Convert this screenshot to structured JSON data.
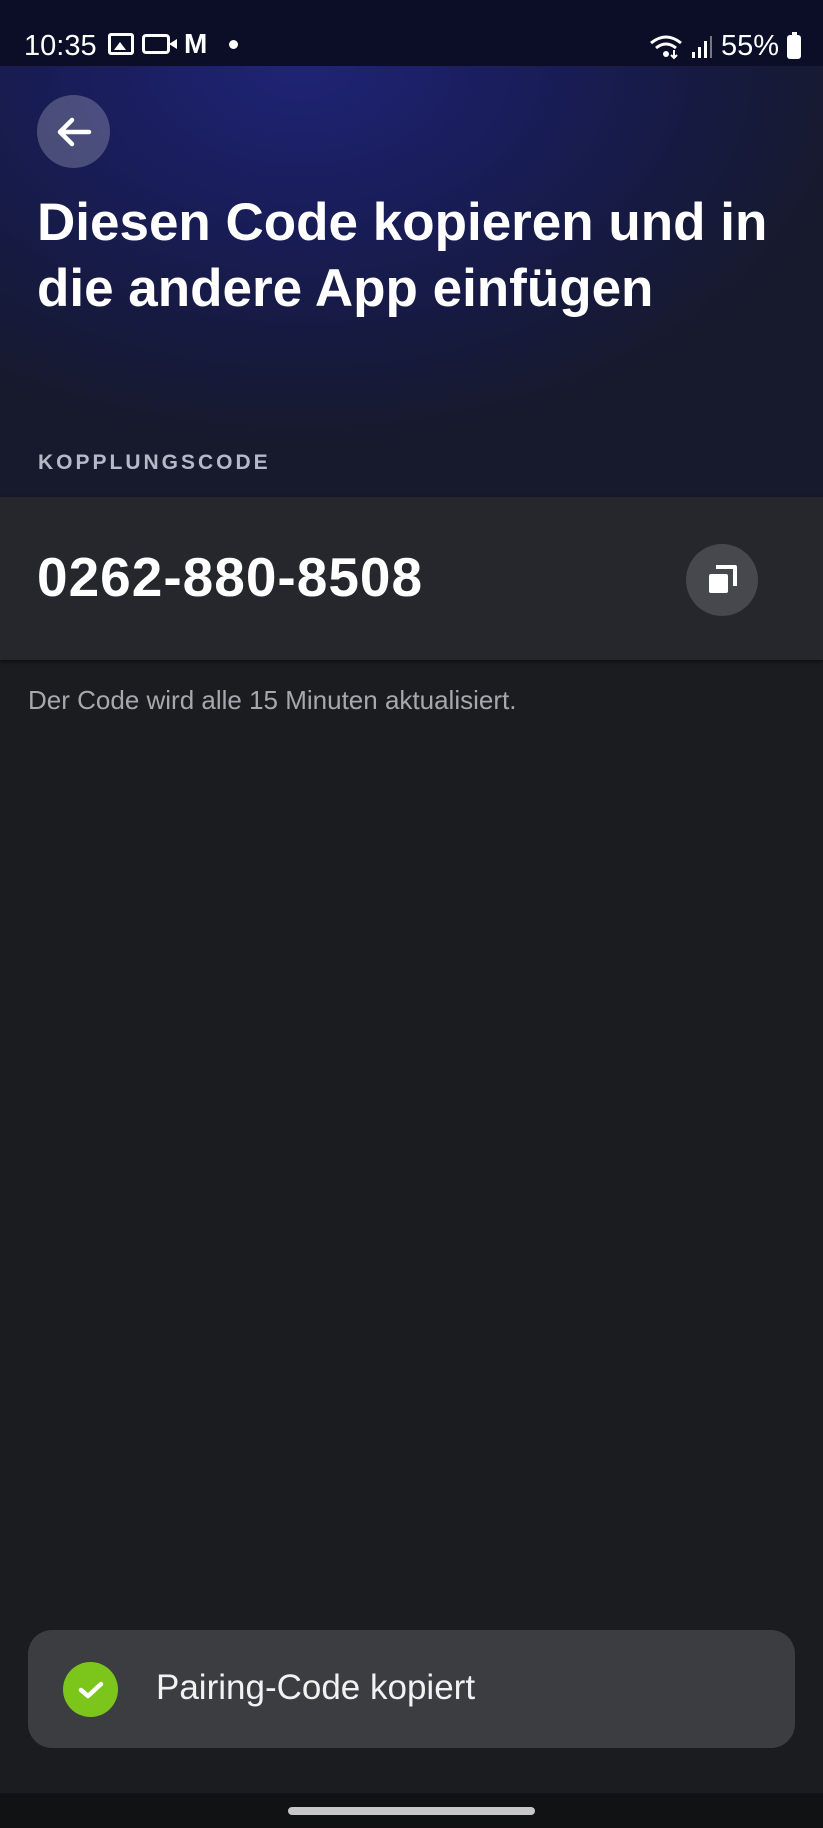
{
  "status_bar": {
    "time": "10:35",
    "battery": "55%",
    "icons": [
      "gallery-icon",
      "video-icon",
      "gmail-icon",
      "notification-dot-icon",
      "wifi-icon",
      "signal-icon",
      "battery-icon"
    ]
  },
  "header": {
    "back_icon": "arrow-left-icon",
    "title": "Diesen Code kopieren und in die andere App einfügen"
  },
  "pairing": {
    "section_label": "KOPPLUNGSCODE",
    "code": "0262-880-8508",
    "copy_icon": "copy-icon",
    "hint": "Der Code wird alle 15 Minuten aktualisiert."
  },
  "toast": {
    "icon": "check-circle-icon",
    "message": "Pairing-Code kopiert"
  },
  "colors": {
    "header_gradient": "#1f2476",
    "background": "#1b1c20",
    "card": "#25272d",
    "toast_bg": "#3c3d41",
    "success": "#7cc61c"
  }
}
